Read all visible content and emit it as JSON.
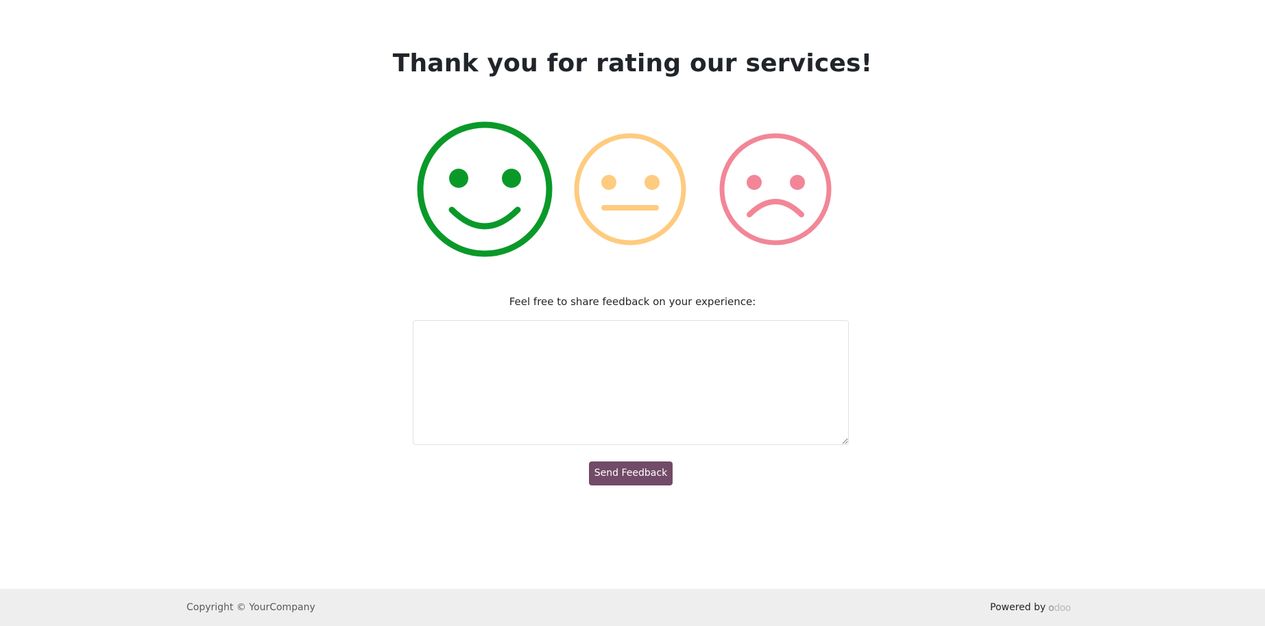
{
  "page": {
    "title": "Thank you for rating our services!"
  },
  "ratings": {
    "happy": {
      "icon": "smiley-happy-icon",
      "color": "#0a9929",
      "selected": true
    },
    "neutral": {
      "icon": "smiley-neutral-icon",
      "color": "#fecb7f",
      "selected": false
    },
    "sad": {
      "icon": "smiley-sad-icon",
      "color": "#f28697",
      "selected": false
    }
  },
  "feedback": {
    "label": "Feel free to share feedback on your experience:",
    "value": "",
    "placeholder": ""
  },
  "send_button": {
    "label": "Send Feedback",
    "color": "#714b67"
  },
  "footer": {
    "copyright": "Copyright © YourCompany",
    "powered_by": "Powered by",
    "logo_text": "odoo"
  }
}
